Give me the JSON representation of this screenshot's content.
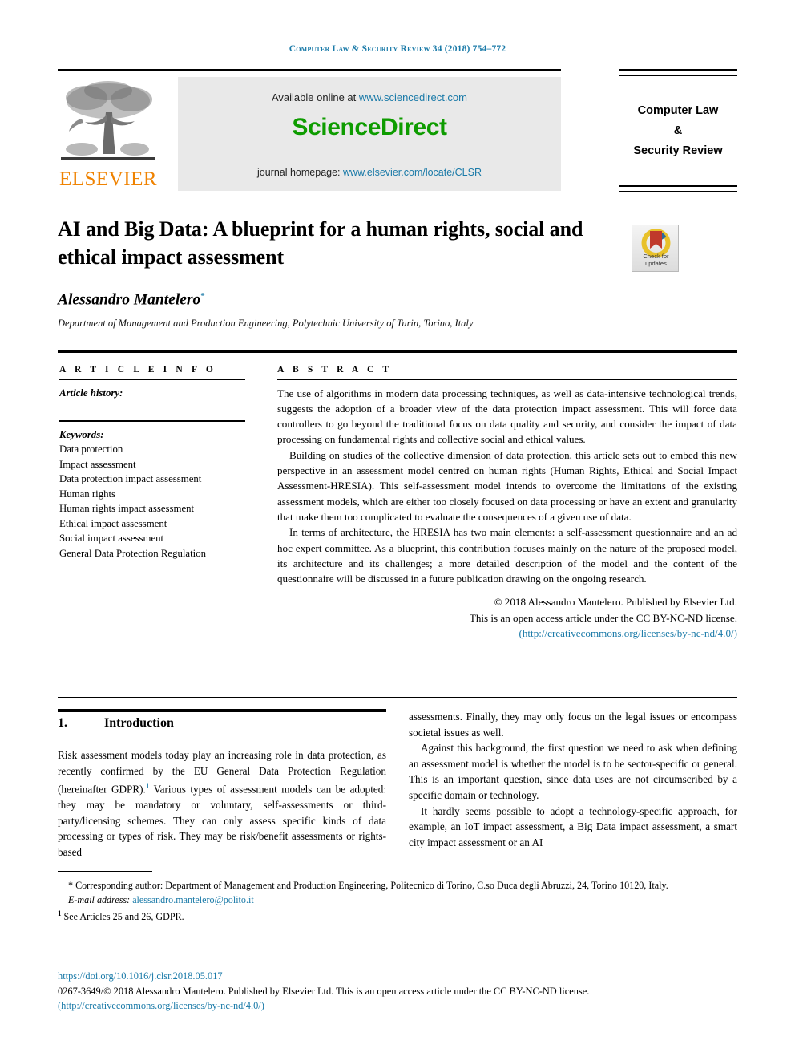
{
  "running_head": "Computer Law & Security Review 34 (2018) 754–772",
  "masthead": {
    "available_prefix": "Available online at ",
    "sciencedirect_url": "www.sciencedirect.com",
    "sciencedirect_logo": "ScienceDirect",
    "homepage_prefix": "journal homepage: ",
    "homepage_url": "www.elsevier.com/locate/CLSR",
    "elsevier_wordmark": "ELSEVIER",
    "journal_title_line1": "Computer Law",
    "journal_title_line2": "&",
    "journal_title_line3": "Security Review"
  },
  "article": {
    "title": "AI and Big Data: A blueprint for a human rights, social and ethical impact assessment",
    "author": "Alessandro Mantelero",
    "author_marker": "*",
    "affiliation": "Department of Management and Production Engineering, Polytechnic University of Turin, Torino, Italy",
    "crossmark_line1": "Check for",
    "crossmark_line2": "updates"
  },
  "info": {
    "heading": "A R T I C L E   I N F O",
    "history_label": "Article history:",
    "keywords_label": "Keywords:",
    "keywords": [
      "Data protection",
      "Impact assessment",
      "Data protection impact assessment",
      "Human rights",
      "Human rights impact assessment",
      "Ethical impact assessment",
      "Social impact assessment",
      "General Data Protection Regulation"
    ]
  },
  "abstract": {
    "heading": "A B S T R A C T",
    "paragraph1": "The use of algorithms in modern data processing techniques, as well as data-intensive technological trends, suggests the adoption of a broader view of the data protection impact assessment. This will force data controllers to go beyond the traditional focus on data quality and security, and consider the impact of data processing on fundamental rights and collective social and ethical values.",
    "paragraph2": "Building on studies of the collective dimension of data protection, this article sets out to embed this new perspective in an assessment model centred on human rights (Human Rights, Ethical and Social Impact Assessment-HRESIA). This self-assessment model intends to overcome the limitations of the existing assessment models, which are either too closely focused on data processing or have an extent and granularity that make them too complicated to evaluate the consequences of a given use of data.",
    "paragraph3": "In terms of architecture, the HRESIA has two main elements: a self-assessment questionnaire and an ad hoc expert committee. As a blueprint, this contribution focuses mainly on the nature of the proposed model, its architecture and its challenges; a more detailed description of the model and the content of the questionnaire will be discussed in a future publication drawing on the ongoing research.",
    "copyright_line1": "© 2018 Alessandro Mantelero. Published by Elsevier Ltd.",
    "copyright_line2": "This is an open access article under the CC BY-NC-ND license.",
    "license_url": "(http://creativecommons.org/licenses/by-nc-nd/4.0/)"
  },
  "body": {
    "section_number": "1.",
    "section_title": "Introduction",
    "left_p1_a": "Risk assessment models today play an increasing role in data protection, as recently confirmed by the EU General Data Protection Regulation (hereinafter GDPR).",
    "left_p1_marker": "1",
    "left_p1_b": " Various types of assessment models can be adopted: they may be mandatory or voluntary, self-assessments or third-party/licensing schemes. They can only assess specific kinds of data processing or types of risk. They may be risk/benefit assessments or rights-based",
    "right_p1": "assessments. Finally, they may only focus on the legal issues or encompass societal issues as well.",
    "right_p2": "Against this background, the first question we need to ask when defining an assessment model is whether the model is to be sector-specific or general. This is an important question, since data uses are not circumscribed by a specific domain or technology.",
    "right_p3": "It hardly seems possible to adopt a technology-specific approach, for example, an IoT impact assessment, a Big Data impact assessment, a smart city impact assessment or an AI"
  },
  "footnotes": {
    "corresponding": "* Corresponding author: Department of Management and Production Engineering, Politecnico di Torino, C.so Duca degli Abruzzi, 24, Torino 10120, Italy.",
    "email_label": "E-mail address:",
    "email": "alessandro.mantelero@polito.it",
    "note1_marker": "1",
    "note1_text": " See Articles 25 and 26, GDPR."
  },
  "bottom": {
    "doi": "https://doi.org/10.1016/j.clsr.2018.05.017",
    "issn_copyright": "0267-3649/© 2018 Alessandro Mantelero. Published by Elsevier Ltd. This is an open access article under the CC BY-NC-ND license.",
    "license_url": "(http://creativecommons.org/licenses/by-nc-nd/4.0/)"
  },
  "colors": {
    "link": "#1a7aa8",
    "sciencedirect_green": "#0e9c00",
    "elsevier_orange": "#ef8200",
    "banner_gray": "#e9e9e9"
  }
}
